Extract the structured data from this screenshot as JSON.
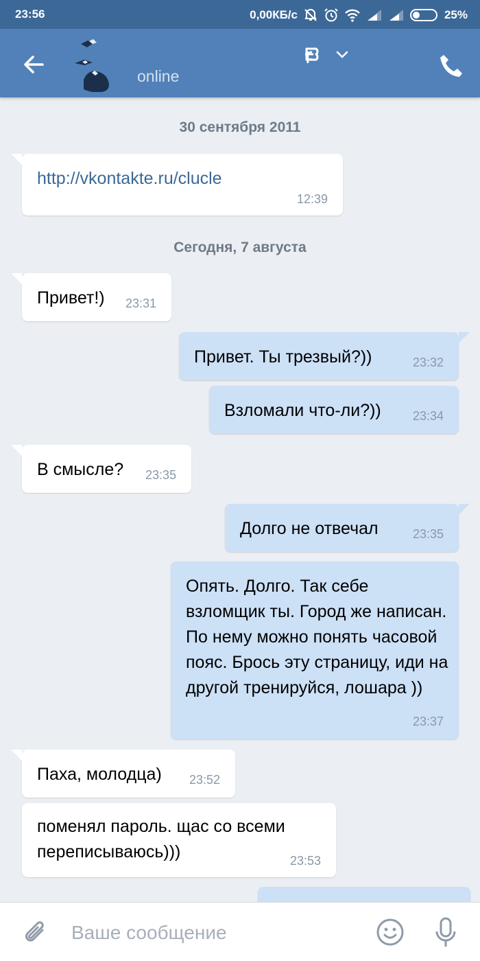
{
  "status_bar": {
    "time": "23:56",
    "network_speed": "0,00КБ/с",
    "battery": "25%",
    "icons": [
      "mute-icon",
      "alarm-icon",
      "wifi-icon",
      "signal-icon",
      "signal-icon",
      "battery-icon"
    ]
  },
  "header": {
    "status": "online",
    "icons": [
      "back-arrow-icon",
      "vk-logo-icon",
      "chevron-down-icon",
      "phone-icon"
    ]
  },
  "chat": {
    "date_1": "30 сентября 2011",
    "date_2": "Сегодня, 7 августа",
    "messages": [
      {
        "dir": "in",
        "text": "http://vkontakte.ru/clucle",
        "time": "12:39"
      },
      {
        "dir": "in",
        "text": "Привет!)",
        "time": "23:31"
      },
      {
        "dir": "out",
        "text": "Привет. Ты трезвый?))",
        "time": "23:32"
      },
      {
        "dir": "out",
        "text": "Взломали что-ли?))",
        "time": "23:34"
      },
      {
        "dir": "in",
        "text": "В смысле?",
        "time": "23:35"
      },
      {
        "dir": "out",
        "text": "Долго не отвечал",
        "time": "23:35"
      },
      {
        "dir": "out",
        "text": "Опять. Долго. Так себе взломщик ты. Город же написан. По нему можно понять часовой пояс. Брось эту страницу, иди на другой тренируйся, лошара ))",
        "time": "23:37"
      },
      {
        "dir": "in",
        "text": "Паха, молодца)",
        "time": "23:52"
      },
      {
        "dir": "in",
        "text": "поменял пароль. щас со всеми переписываюсь)))",
        "time": "23:53"
      }
    ]
  },
  "input_bar": {
    "placeholder": "Ваше сообщение",
    "icons": [
      "attach-icon",
      "smile-icon",
      "microphone-icon"
    ]
  },
  "colors": {
    "status_bar": "#3c6897",
    "header": "#5181b8",
    "chat_bg": "#ebeef2",
    "incoming_bubble": "#ffffff",
    "outgoing_bubble": "#cce0f6",
    "link": "#3c6897"
  }
}
